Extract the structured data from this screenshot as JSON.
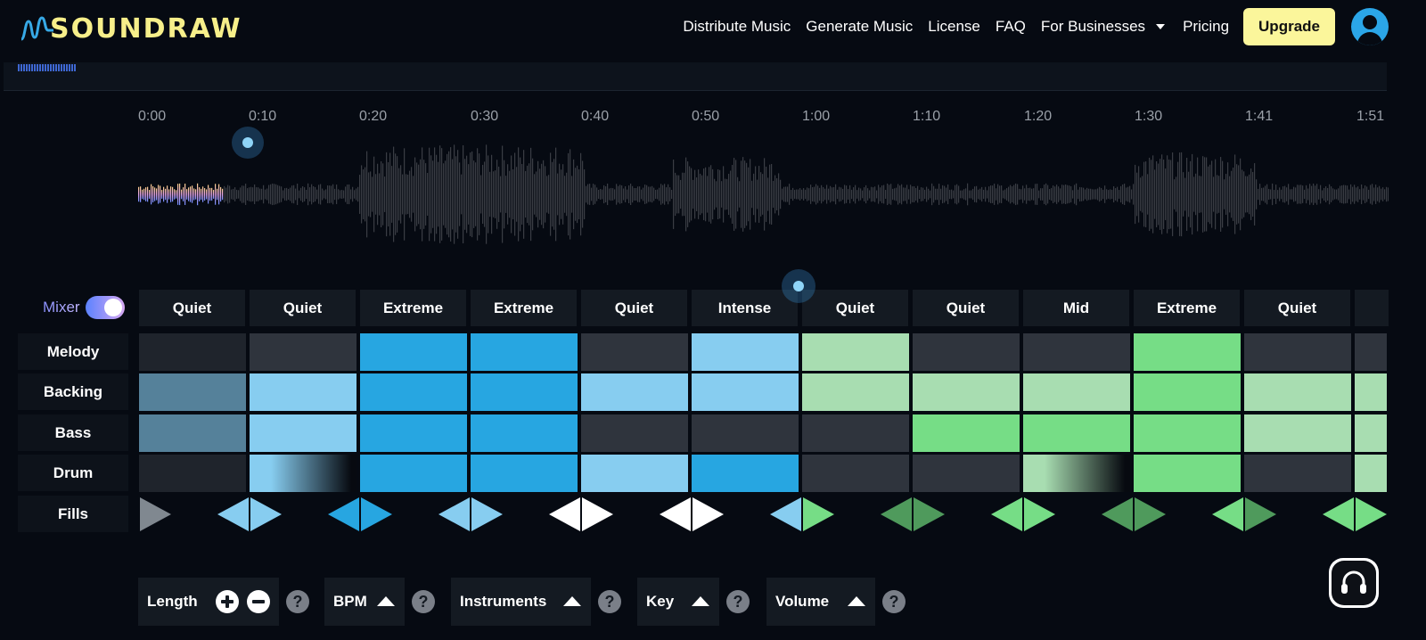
{
  "brand": {
    "name": "SOUNDRAW"
  },
  "nav": {
    "links": [
      "Distribute Music",
      "Generate Music",
      "License",
      "FAQ"
    ],
    "businesses": "For Businesses",
    "pricing": "Pricing",
    "upgrade": "Upgrade"
  },
  "timeline": {
    "ticks": [
      "0:00",
      "0:10",
      "0:20",
      "0:30",
      "0:40",
      "0:50",
      "1:00",
      "1:10",
      "1:20",
      "1:30",
      "1:41",
      "1:51"
    ]
  },
  "mixer": {
    "label": "Mixer",
    "enabled": true
  },
  "sections": [
    "Quiet",
    "Quiet",
    "Extreme",
    "Extreme",
    "Quiet",
    "Intense",
    "Quiet",
    "Quiet",
    "Mid",
    "Extreme",
    "Quiet",
    ""
  ],
  "rows": [
    "Melody",
    "Backing",
    "Bass",
    "Drum",
    "Fills"
  ],
  "colors": {
    "off": "#2f343d",
    "dark": "#1f242c",
    "muted_blue": "#55819a",
    "light_blue": "#87cdf0",
    "blue": "#27a6e1",
    "light_green": "#a8ddb1",
    "green": "#76dd86"
  },
  "toolbar": {
    "length": "Length",
    "bpm": "BPM",
    "instruments": "Instruments",
    "key": "Key",
    "volume": "Volume",
    "help": "?"
  }
}
